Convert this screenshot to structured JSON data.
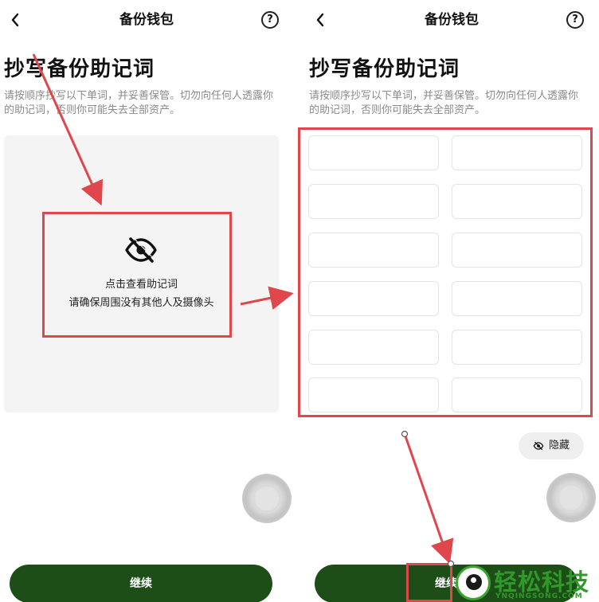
{
  "left_panel": {
    "nav_title": "备份钱包",
    "help_label": "?",
    "page_title": "抄写备份助记词",
    "description": "请按顺序抄写以下单词，并妥善保管。切勿向任何人透露你的助记词，否则你可能失去全部资产。",
    "reveal": {
      "icon": "eye-slash-icon",
      "line1": "点击查看助记词",
      "line2": "请确保周围没有其他人及摄像头"
    },
    "continue_label": "继续"
  },
  "right_panel": {
    "nav_title": "备份钱包",
    "help_label": "?",
    "page_title": "抄写备份助记词",
    "description": "请按顺序抄写以下单词，并妥善保管。切勿向任何人透露你的助记词，否则你可能失去全部资产。",
    "words": [
      "",
      "",
      "",
      "",
      "",
      "",
      "",
      "",
      "",
      "",
      "",
      ""
    ],
    "hide_label": "隐藏",
    "hide_icon": "eye-slash-icon",
    "continue_label": "继续"
  },
  "watermark": {
    "brand": "轻松科技",
    "url": "YNQINGSONG.COM"
  },
  "colors": {
    "accent_green": "#1d4e18",
    "annotation_red": "#e0474c",
    "brand_green": "#2f9a27"
  }
}
